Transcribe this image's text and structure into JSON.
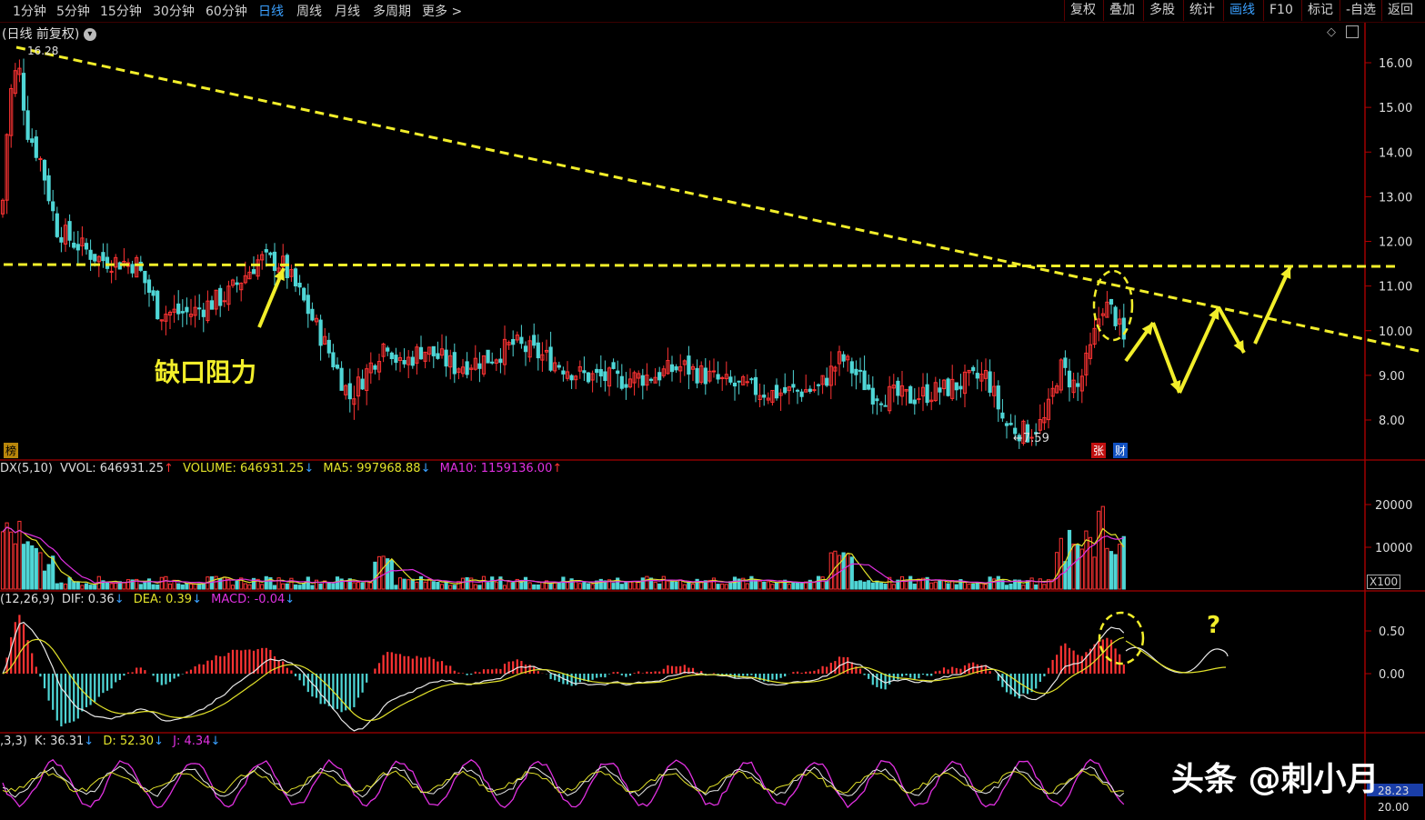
{
  "toolbar": {
    "periods": [
      "1分钟",
      "5分钟",
      "15分钟",
      "30分钟",
      "60分钟",
      "日线",
      "周线",
      "月线",
      "多周期",
      "更多 >"
    ],
    "active_period": "日线",
    "tools": [
      "复权",
      "叠加",
      "多股",
      "统计",
      "画线",
      "F10",
      "标记",
      "-自选",
      "返回"
    ],
    "active_tool": "画线"
  },
  "price_panel": {
    "title": "(日线 前复权)",
    "high_label": "16.28",
    "low_label": "7.59",
    "axis_ticks": [
      "16.00",
      "15.00",
      "14.00",
      "13.00",
      "12.00",
      "11.00",
      "10.00",
      "9.00",
      "8.00"
    ],
    "annotation": "缺口阻力",
    "badge_left": "榜",
    "badge_zhang": "张",
    "badge_cai": "财"
  },
  "volume_panel": {
    "name": "DX(5,10)",
    "vol": "VVOL: 646931.25",
    "volume": "VOLUME: 646931.25",
    "ma5": "MA5: 997968.88",
    "ma10": "MA10: 1159136.00",
    "axis_ticks": [
      "20000",
      "10000"
    ],
    "unit": "X100"
  },
  "macd_panel": {
    "name": "(12,26,9)",
    "dif": "DIF: 0.36",
    "dea": "DEA: 0.39",
    "macd": "MACD: -0.04",
    "axis_ticks": [
      "0.50",
      "0.00"
    ],
    "question": "?"
  },
  "kdj_panel": {
    "name": ",3,3)",
    "k": "K: 36.31",
    "d": "D: 52.30",
    "j": "J: 4.34",
    "axis_ticks": [
      "28.23",
      "20.00"
    ]
  },
  "watermark": "头条 @刺小月",
  "colors": {
    "up": "#ff3333",
    "down": "#4fd6d6",
    "drawline": "#f2ee2a",
    "axis": "#b00000",
    "ma_white": "#e8e8e8",
    "ma_yellow": "#e2e22a",
    "ma_magenta": "#e030e0",
    "active": "#3aa0ff"
  }
}
